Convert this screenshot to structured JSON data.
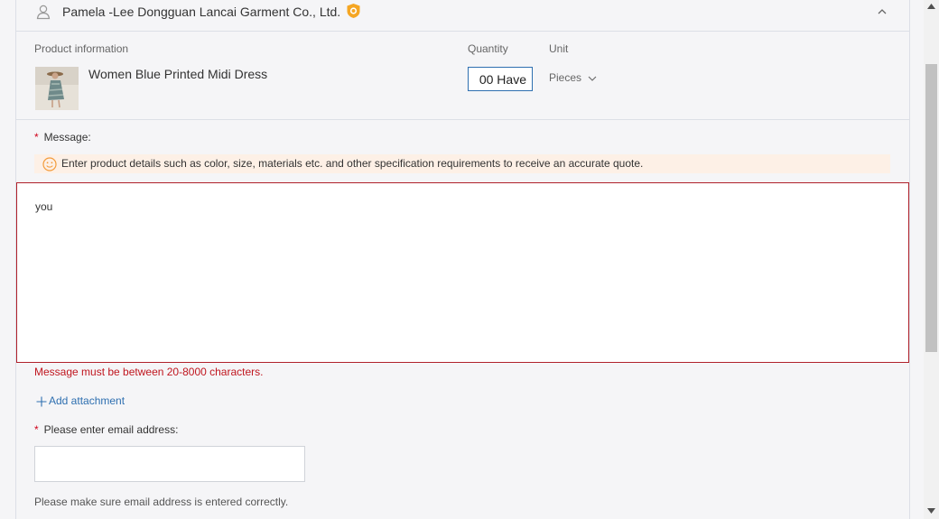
{
  "supplier": {
    "name": "Pamela -Lee Dongguan Lancai Garment Co., Ltd."
  },
  "product": {
    "info_label": "Product information",
    "quantity_label": "Quantity",
    "unit_label": "Unit",
    "name": "Women Blue Printed Midi Dress",
    "quantity_value": "00 Have",
    "unit_value": "Pieces"
  },
  "message": {
    "label": "Message:",
    "tip": "Enter product details such as color, size, materials etc. and other specification requirements to receive an accurate quote.",
    "value": "you",
    "error": "Message must be between 20-8000 characters."
  },
  "attachment": {
    "label": "Add attachment"
  },
  "email": {
    "label": "Please enter email address:",
    "value": "",
    "hint": "Please make sure email address is entered correctly."
  },
  "colors": {
    "accent": "#2e6fb0",
    "error": "#c0161f",
    "tip_background": "#fdf0e6",
    "badge": "#f5a623"
  },
  "icons": [
    "user-icon",
    "gold-supplier-badge-icon",
    "chevron-up-icon",
    "chevron-down-icon",
    "smile-icon",
    "plus-icon"
  ]
}
